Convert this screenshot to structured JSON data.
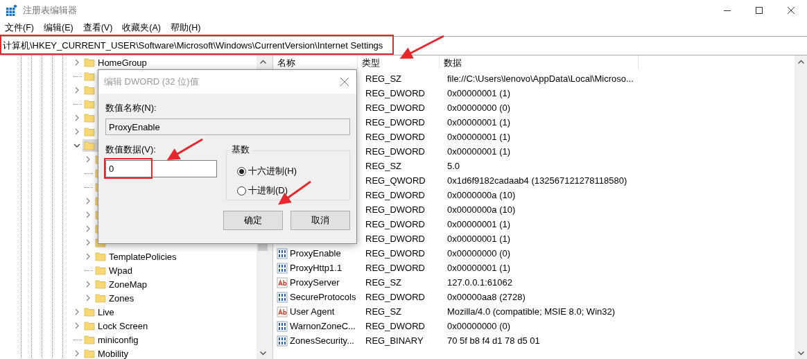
{
  "window": {
    "title": "注册表编辑器"
  },
  "menu": [
    "文件(F)",
    "编辑(E)",
    "查看(V)",
    "收藏夹(A)",
    "帮助(H)"
  ],
  "address_bar": {
    "value": "计算机\\HKEY_CURRENT_USER\\Software\\Microsoft\\Windows\\CurrentVersion\\Internet Settings"
  },
  "tree": {
    "items": [
      {
        "label": "HomeGroup",
        "expandable": true,
        "expanded": false,
        "selected": false
      },
      {
        "expandable": false,
        "selected": false
      },
      {
        "expandable": true,
        "expanded": false,
        "selected": false
      },
      {
        "expandable": false,
        "selected": false
      },
      {
        "expandable": true,
        "expanded": false,
        "selected": false
      },
      {
        "expandable": true,
        "expanded": false,
        "selected": false
      },
      {
        "expandable": true,
        "expanded": true,
        "selected": true,
        "children": [
          {
            "expandable": true,
            "expanded": false,
            "selected": false
          },
          {
            "expandable": false,
            "selected": false
          },
          {
            "expandable": false,
            "selected": false
          },
          {
            "expandable": true,
            "expanded": false,
            "selected": false
          },
          {
            "expandable": true,
            "expanded": false,
            "selected": false
          },
          {
            "expandable": true,
            "expanded": false,
            "selected": false
          },
          {
            "expandable": true,
            "expanded": false,
            "selected": false
          },
          {
            "label": "TemplatePolicies",
            "expandable": true,
            "expanded": false,
            "selected": false
          },
          {
            "label": "Wpad",
            "expandable": false,
            "selected": false
          },
          {
            "label": "ZoneMap",
            "expandable": true,
            "expanded": false,
            "selected": false
          },
          {
            "label": "Zones",
            "expandable": true,
            "expanded": false,
            "selected": false
          }
        ]
      },
      {
        "label": "Live",
        "expandable": true,
        "expanded": false,
        "selected": false
      },
      {
        "label": "Lock Screen",
        "expandable": true,
        "expanded": false,
        "selected": false
      },
      {
        "label": "miniconfig",
        "expandable": false,
        "selected": false
      },
      {
        "label": "Mobility",
        "expandable": true,
        "expanded": false,
        "selected": false
      }
    ]
  },
  "values": {
    "columns": [
      "名称",
      "类型",
      "数据"
    ],
    "rows": [
      {
        "type": "REG_SZ",
        "data": "file://C:\\Users\\lenovo\\AppData\\Local\\Microso..."
      },
      {
        "type": "REG_DWORD",
        "data": "0x00000001 (1)"
      },
      {
        "type": "REG_DWORD",
        "data": "0x00000000 (0)"
      },
      {
        "type": "REG_DWORD",
        "data": "0x00000001 (1)"
      },
      {
        "type": "REG_DWORD",
        "data": "0x00000001 (1)"
      },
      {
        "type": "REG_DWORD",
        "data": "0x00000001 (1)"
      },
      {
        "type": "REG_SZ",
        "data": "5.0"
      },
      {
        "type": "REG_QWORD",
        "data": "0x1d6f9182cadaab4 (132567121278118580)"
      },
      {
        "type": "REG_DWORD",
        "data": "0x0000000a (10)"
      },
      {
        "type": "REG_DWORD",
        "data": "0x0000000a (10)"
      },
      {
        "type": "REG_DWORD",
        "data": "0x00000001 (1)"
      },
      {
        "type": "REG_DWORD",
        "data": "0x00000001 (1)"
      },
      {
        "name": "ProxyEnable",
        "kind": "binary",
        "type": "REG_DWORD",
        "data": "0x00000000 (0)"
      },
      {
        "name": "ProxyHttp1.1",
        "kind": "binary",
        "type": "REG_DWORD",
        "data": "0x00000001 (1)"
      },
      {
        "name": "ProxyServer",
        "kind": "string",
        "type": "REG_SZ",
        "data": "127.0.0.1:61062"
      },
      {
        "name": "SecureProtocols",
        "kind": "binary",
        "type": "REG_DWORD",
        "data": "0x00000aa8 (2728)"
      },
      {
        "name": "User Agent",
        "kind": "string",
        "type": "REG_SZ",
        "data": "Mozilla/4.0 (compatible; MSIE 8.0; Win32)"
      },
      {
        "name": "WarnonZoneC...",
        "kind": "binary",
        "type": "REG_DWORD",
        "data": "0x00000000 (0)"
      },
      {
        "name": "ZonesSecurity...",
        "kind": "binary",
        "type": "REG_BINARY",
        "data": "70 5f b8 f4 d1 78 d5 01"
      }
    ]
  },
  "dialog": {
    "title": "编辑 DWORD (32 位)值",
    "name_label": "数值名称(N):",
    "name_value": "ProxyEnable",
    "data_label": "数值数据(V):",
    "data_value": "0",
    "base": {
      "title": "基数",
      "options": [
        {
          "label": "十六进制(H)",
          "selected": true
        },
        {
          "label": "十进制(D)",
          "selected": false
        }
      ]
    },
    "buttons": [
      "确定",
      "取消"
    ]
  }
}
